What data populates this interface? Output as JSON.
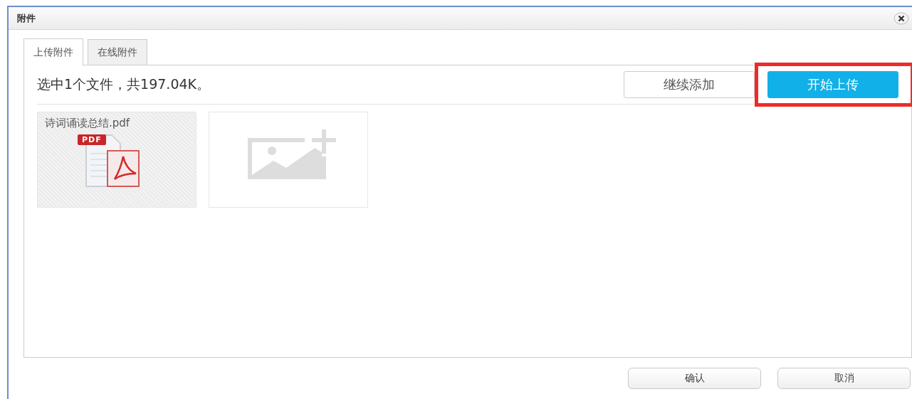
{
  "window": {
    "title": "附件"
  },
  "tabs": [
    {
      "label": "上传附件",
      "selected": true
    },
    {
      "label": "在线附件",
      "selected": false
    }
  ],
  "status": "选中1个文件，共197.04K。",
  "actions": [
    {
      "label": "继续添加",
      "kind": "secondary",
      "highlighted": false
    },
    {
      "label": "开始上传",
      "kind": "primary",
      "highlighted": true
    }
  ],
  "files": [
    {
      "kind": "pdf",
      "name": "诗词诵读总结.pdf",
      "badge": "PDF"
    },
    {
      "kind": "add"
    }
  ],
  "buttons": [
    "确认",
    "取消"
  ]
}
